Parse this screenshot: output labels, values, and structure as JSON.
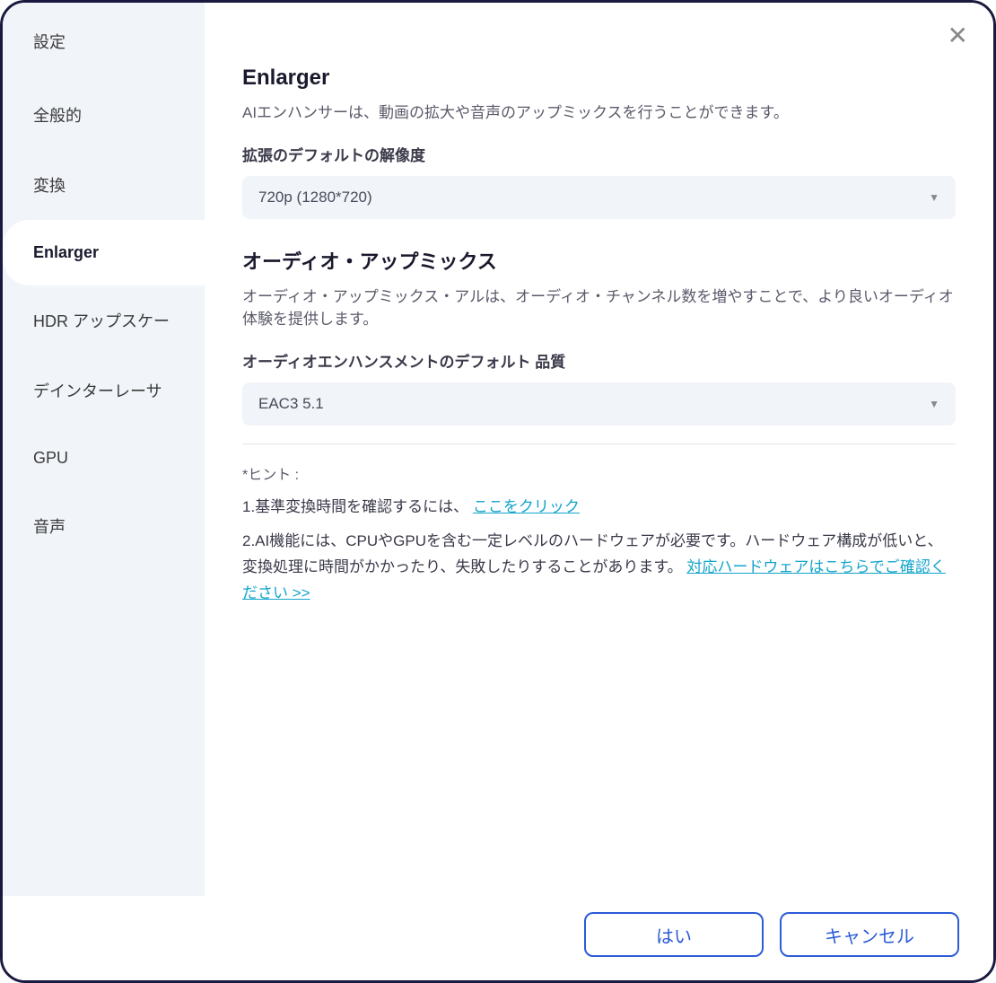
{
  "dialog": {
    "title": "設定"
  },
  "sidebar": {
    "items": [
      {
        "label": "全般的"
      },
      {
        "label": "変換"
      },
      {
        "label": "Enlarger"
      },
      {
        "label": "HDR アップスケー"
      },
      {
        "label": "デインターレーサ"
      },
      {
        "label": "GPU"
      },
      {
        "label": "音声"
      }
    ]
  },
  "content": {
    "section_title": "Enlarger",
    "section_desc": "AIエンハンサーは、動画の拡大や音声のアップミックスを行うことができます。",
    "resolution_label": "拡張のデフォルトの解像度",
    "resolution_value": "720p (1280*720)",
    "audio_header": "オーディオ・アップミックス",
    "audio_desc": "オーディオ・アップミックス・アルは、オーディオ・チャンネル数を増やすことで、より良いオーディオ体験を提供します。",
    "audio_quality_label": "オーディオエンハンスメントのデフォルト 品質",
    "audio_quality_value": "EAC3 5.1",
    "hint_label": "*ヒント :",
    "hint1_prefix": "1.基準変換時間を確認するには、",
    "hint1_link": "ここをクリック",
    "hint2_prefix": "2.AI機能には、CPUやGPUを含む一定レベルのハードウェアが必要です。ハードウェア構成が低いと、変換処理に時間がかかったり、失敗したりすることがあります。",
    "hint2_link": "対応ハードウェアはこちらでご確認ください >>"
  },
  "footer": {
    "ok_label": "はい",
    "cancel_label": "キャンセル"
  }
}
